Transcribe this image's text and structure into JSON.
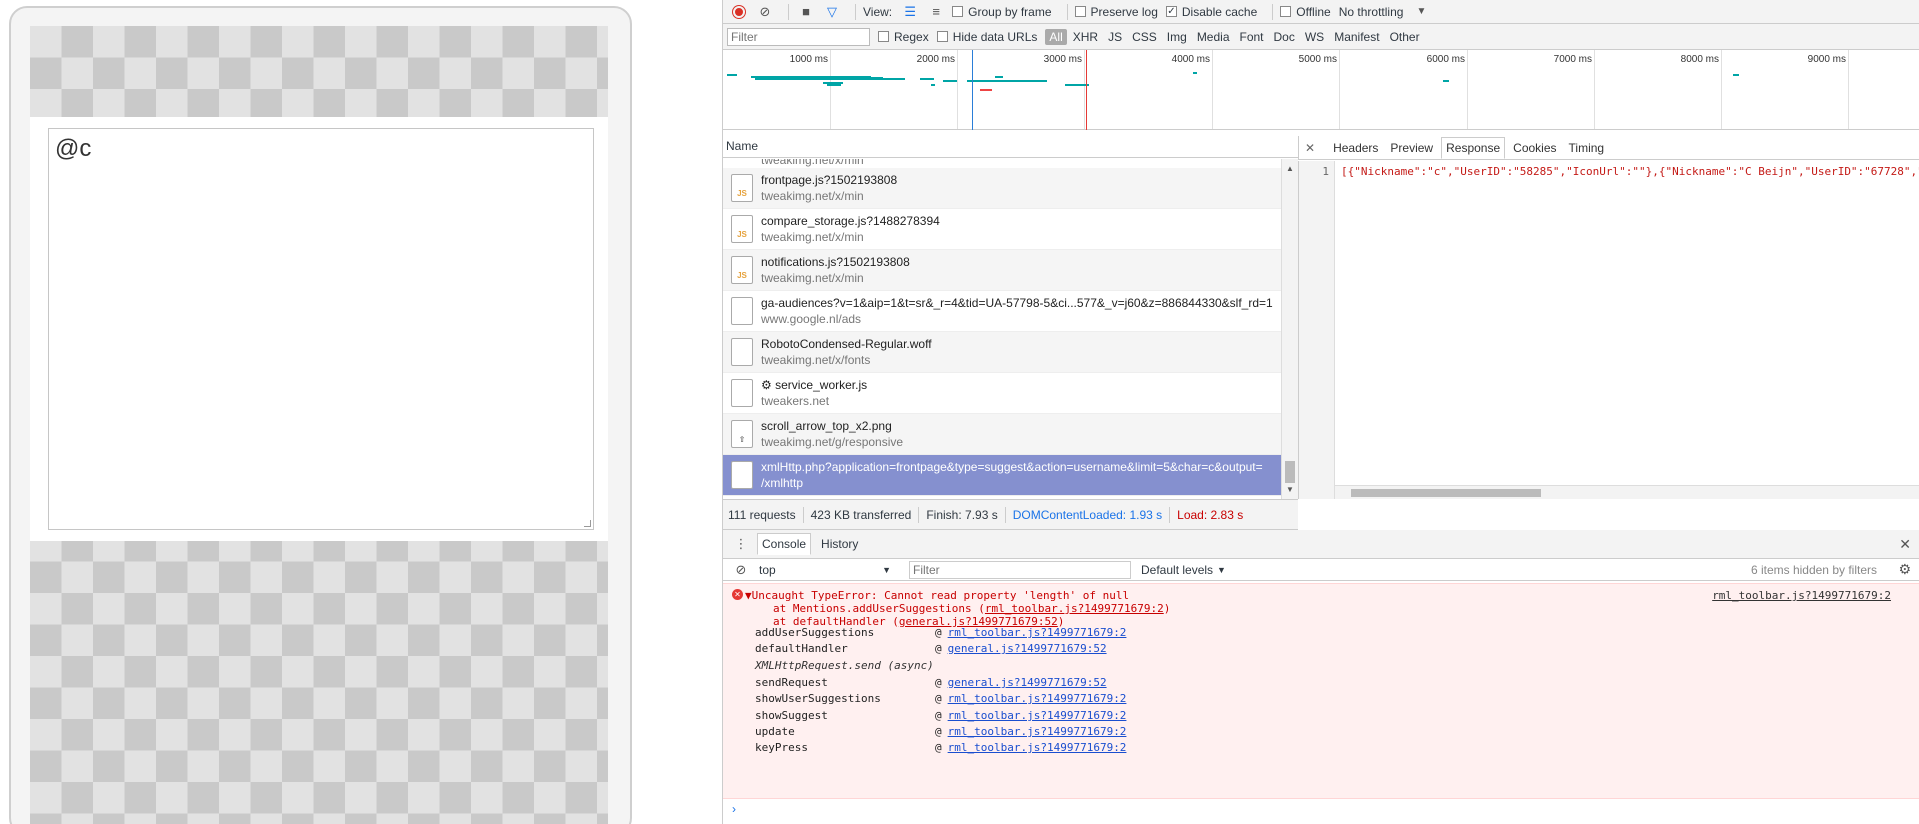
{
  "page": {
    "editor_text": "@c"
  },
  "network_toolbar": {
    "view_label": "View:",
    "group_by_frame": "Group by frame",
    "preserve_log": "Preserve log",
    "disable_cache": "Disable cache",
    "offline": "Offline",
    "throttling": "No throttling"
  },
  "filter_bar": {
    "filter_placeholder": "Filter",
    "regex": "Regex",
    "hide_data_urls": "Hide data URLs",
    "types": [
      "All",
      "XHR",
      "JS",
      "CSS",
      "Img",
      "Media",
      "Font",
      "Doc",
      "WS",
      "Manifest",
      "Other"
    ]
  },
  "overview": {
    "ticks": [
      "1000 ms",
      "2000 ms",
      "3000 ms",
      "4000 ms",
      "5000 ms",
      "6000 ms",
      "7000 ms",
      "8000 ms",
      "9000 ms"
    ]
  },
  "requests": {
    "header": "Name",
    "partial_top": "tweakimg.net/x/min",
    "items": [
      {
        "name": "frontpage.js?1502193808",
        "host": "tweakimg.net/x/min",
        "icon": "js-file-icon"
      },
      {
        "name": "compare_storage.js?1488278394",
        "host": "tweakimg.net/x/min",
        "icon": "js-file-icon"
      },
      {
        "name": "notifications.js?1502193808",
        "host": "tweakimg.net/x/min",
        "icon": "js-file-icon"
      },
      {
        "name": "ga-audiences?v=1&aip=1&t=sr&_r=4&tid=UA-57798-5&ci...577&_v=j60&z=886844330&slf_rd=1",
        "host": "www.google.nl/ads",
        "icon": "doc-file-icon"
      },
      {
        "name": "RobotoCondensed-Regular.woff",
        "host": "tweakimg.net/x/fonts",
        "icon": "doc-file-icon"
      },
      {
        "name": "⚙ service_worker.js",
        "host": "tweakers.net",
        "icon": "doc-file-icon"
      },
      {
        "name": "scroll_arrow_top_x2.png",
        "host": "tweakimg.net/g/responsive",
        "icon": "image-file-icon"
      },
      {
        "name": "xmlHttp.php?application=frontpage&type=suggest&action=username&limit=5&char=c&output=",
        "host": "/xmlhttp",
        "icon": "doc-file-icon",
        "selected": true
      }
    ]
  },
  "detail": {
    "tabs": [
      "Headers",
      "Preview",
      "Response",
      "Cookies",
      "Timing"
    ],
    "active_tab": "Response",
    "line_number": "1",
    "response": "[{\"Nickname\":\"c\",\"UserID\":\"58285\",\"IconUrl\":\"\"},{\"Nickname\":\"C Beijn\",\"UserID\":\"67728\",\"I"
  },
  "summary": {
    "requests": "111 requests",
    "transferred": "423 KB transferred",
    "finish": "Finish: 7.93 s",
    "domcontentloaded": "DOMContentLoaded: 1.93 s",
    "load": "Load: 2.83 s"
  },
  "console_tabs": {
    "console": "Console",
    "history": "History"
  },
  "console_toolbar": {
    "context": "top",
    "filter_placeholder": "Filter",
    "levels": "Default levels",
    "hidden": "6 items hidden by filters"
  },
  "error": {
    "message": "▼Uncaught TypeError: Cannot read property 'length' of null",
    "line2_prefix": "at Mentions.addUserSuggestions (",
    "line2_link": "rml_toolbar.js?1499771679:2",
    "line2_suffix": ")",
    "line3_prefix": "at defaultHandler (",
    "line3_link": "general.js?1499771679:52",
    "line3_suffix": ")",
    "source": "rml_toolbar.js?1499771679:2",
    "async_label": "XMLHttpRequest.send (async)",
    "frames": [
      {
        "fn": "addUserSuggestions",
        "src": "rml_toolbar.js?1499771679:2"
      },
      {
        "fn": "defaultHandler",
        "src": "general.js?1499771679:52"
      },
      {
        "fn": "sendRequest",
        "src": "general.js?1499771679:52"
      },
      {
        "fn": "showUserSuggestions",
        "src": "rml_toolbar.js?1499771679:2"
      },
      {
        "fn": "showSuggest",
        "src": "rml_toolbar.js?1499771679:2"
      },
      {
        "fn": "update",
        "src": "rml_toolbar.js?1499771679:2"
      },
      {
        "fn": "keyPress",
        "src": "rml_toolbar.js?1499771679:2"
      }
    ]
  },
  "colors": {
    "selected_row": "#8590cf",
    "error_bg": "#fff0f0",
    "record": "#d93025",
    "waterfall": "#00a5a6"
  }
}
